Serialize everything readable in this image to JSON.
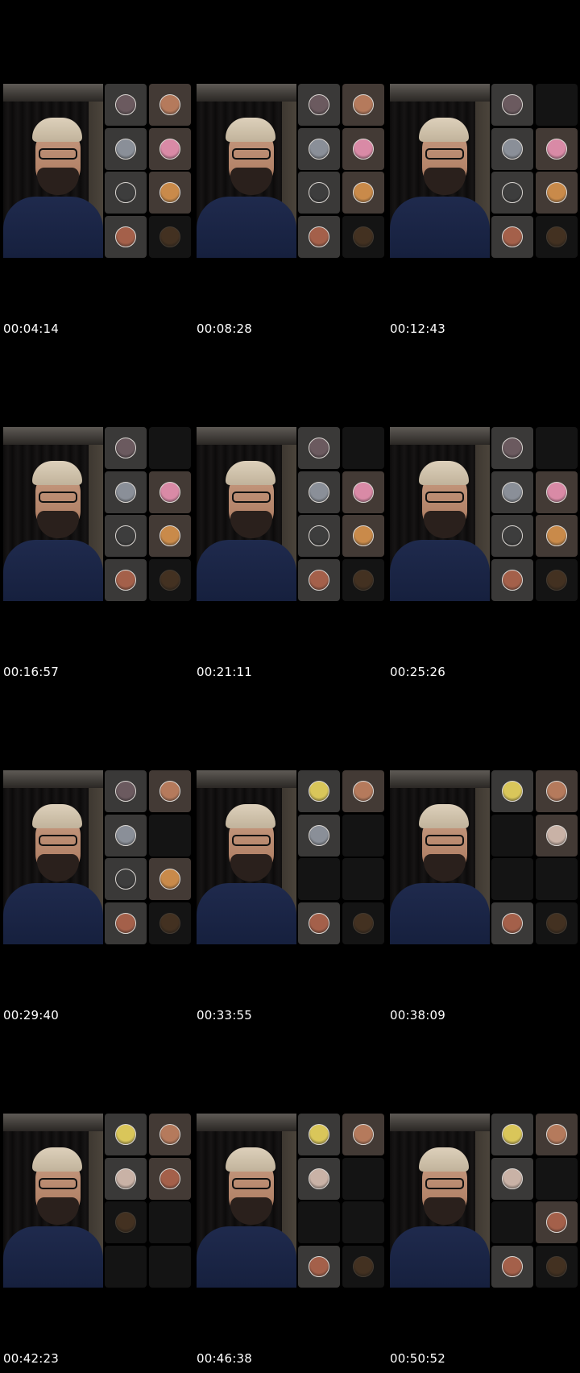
{
  "avatar_colors": {
    "p1": "#6b5a5f",
    "p2": "#b57a5c",
    "p3": "#8a8f98",
    "p4": "#d98aa6",
    "p5": "#3d3d3d",
    "p6": "#c98a4a",
    "p7": "#a4604a",
    "p8": "#6b4a2c",
    "p9": "#d9c65a",
    "p10": "#c9b2a6"
  },
  "frames": [
    {
      "timestamp": "00:04:14",
      "tiles": [
        {
          "state": "on",
          "avatar": "p1"
        },
        {
          "state": "on",
          "avatar": "p2"
        },
        {
          "state": "on",
          "avatar": "p3"
        },
        {
          "state": "on",
          "avatar": "p4"
        },
        {
          "state": "on",
          "avatar": "p5"
        },
        {
          "state": "on",
          "avatar": "p6"
        },
        {
          "state": "on",
          "avatar": "p7"
        },
        {
          "state": "off",
          "avatar": "p8"
        }
      ]
    },
    {
      "timestamp": "00:08:28",
      "tiles": [
        {
          "state": "on",
          "avatar": "p1"
        },
        {
          "state": "on",
          "avatar": "p2"
        },
        {
          "state": "on",
          "avatar": "p3"
        },
        {
          "state": "on",
          "avatar": "p4"
        },
        {
          "state": "on",
          "avatar": "p5"
        },
        {
          "state": "on",
          "avatar": "p6"
        },
        {
          "state": "on",
          "avatar": "p7"
        },
        {
          "state": "off",
          "avatar": "p8"
        }
      ]
    },
    {
      "timestamp": "00:12:43",
      "tiles": [
        {
          "state": "on",
          "avatar": "p1"
        },
        {
          "state": "empty",
          "avatar": ""
        },
        {
          "state": "on",
          "avatar": "p3"
        },
        {
          "state": "on",
          "avatar": "p4"
        },
        {
          "state": "on",
          "avatar": "p5"
        },
        {
          "state": "on",
          "avatar": "p6"
        },
        {
          "state": "on",
          "avatar": "p7"
        },
        {
          "state": "off",
          "avatar": "p8"
        }
      ]
    },
    {
      "timestamp": "00:16:57",
      "tiles": [
        {
          "state": "on",
          "avatar": "p1"
        },
        {
          "state": "empty",
          "avatar": ""
        },
        {
          "state": "on",
          "avatar": "p3"
        },
        {
          "state": "on",
          "avatar": "p4"
        },
        {
          "state": "on",
          "avatar": "p5"
        },
        {
          "state": "on",
          "avatar": "p6"
        },
        {
          "state": "on",
          "avatar": "p7"
        },
        {
          "state": "off",
          "avatar": "p8"
        }
      ]
    },
    {
      "timestamp": "00:21:11",
      "tiles": [
        {
          "state": "on",
          "avatar": "p1"
        },
        {
          "state": "empty",
          "avatar": ""
        },
        {
          "state": "on",
          "avatar": "p3"
        },
        {
          "state": "on",
          "avatar": "p4"
        },
        {
          "state": "on",
          "avatar": "p5"
        },
        {
          "state": "on",
          "avatar": "p6"
        },
        {
          "state": "on",
          "avatar": "p7"
        },
        {
          "state": "off",
          "avatar": "p8"
        }
      ]
    },
    {
      "timestamp": "00:25:26",
      "tiles": [
        {
          "state": "on",
          "avatar": "p1"
        },
        {
          "state": "empty",
          "avatar": ""
        },
        {
          "state": "on",
          "avatar": "p3"
        },
        {
          "state": "on",
          "avatar": "p4"
        },
        {
          "state": "on",
          "avatar": "p5"
        },
        {
          "state": "on",
          "avatar": "p6"
        },
        {
          "state": "on",
          "avatar": "p7"
        },
        {
          "state": "off",
          "avatar": "p8"
        }
      ]
    },
    {
      "timestamp": "00:29:40",
      "tiles": [
        {
          "state": "on",
          "avatar": "p1"
        },
        {
          "state": "on",
          "avatar": "p2"
        },
        {
          "state": "on",
          "avatar": "p3"
        },
        {
          "state": "empty",
          "avatar": ""
        },
        {
          "state": "on",
          "avatar": "p5"
        },
        {
          "state": "on",
          "avatar": "p6"
        },
        {
          "state": "on",
          "avatar": "p7"
        },
        {
          "state": "off",
          "avatar": "p8"
        }
      ]
    },
    {
      "timestamp": "00:33:55",
      "tiles": [
        {
          "state": "on",
          "avatar": "p9"
        },
        {
          "state": "on",
          "avatar": "p2"
        },
        {
          "state": "on",
          "avatar": "p3"
        },
        {
          "state": "empty",
          "avatar": ""
        },
        {
          "state": "empty",
          "avatar": ""
        },
        {
          "state": "empty",
          "avatar": ""
        },
        {
          "state": "on",
          "avatar": "p7"
        },
        {
          "state": "off",
          "avatar": "p8"
        }
      ]
    },
    {
      "timestamp": "00:38:09",
      "tiles": [
        {
          "state": "on",
          "avatar": "p9"
        },
        {
          "state": "on",
          "avatar": "p2"
        },
        {
          "state": "empty",
          "avatar": ""
        },
        {
          "state": "on",
          "avatar": "p10"
        },
        {
          "state": "empty",
          "avatar": ""
        },
        {
          "state": "empty",
          "avatar": ""
        },
        {
          "state": "on",
          "avatar": "p7"
        },
        {
          "state": "off",
          "avatar": "p8"
        }
      ]
    },
    {
      "timestamp": "00:42:23",
      "tiles": [
        {
          "state": "on",
          "avatar": "p9"
        },
        {
          "state": "on",
          "avatar": "p2"
        },
        {
          "state": "on",
          "avatar": "p10"
        },
        {
          "state": "on",
          "avatar": "p7"
        },
        {
          "state": "off",
          "avatar": "p8"
        },
        {
          "state": "empty",
          "avatar": ""
        },
        {
          "state": "empty",
          "avatar": ""
        },
        {
          "state": "empty",
          "avatar": ""
        }
      ]
    },
    {
      "timestamp": "00:46:38",
      "tiles": [
        {
          "state": "on",
          "avatar": "p9"
        },
        {
          "state": "on",
          "avatar": "p2"
        },
        {
          "state": "on",
          "avatar": "p10"
        },
        {
          "state": "empty",
          "avatar": ""
        },
        {
          "state": "empty",
          "avatar": ""
        },
        {
          "state": "empty",
          "avatar": ""
        },
        {
          "state": "on",
          "avatar": "p7"
        },
        {
          "state": "off",
          "avatar": "p8"
        }
      ]
    },
    {
      "timestamp": "00:50:52",
      "tiles": [
        {
          "state": "on",
          "avatar": "p9"
        },
        {
          "state": "on",
          "avatar": "p2"
        },
        {
          "state": "on",
          "avatar": "p10"
        },
        {
          "state": "empty",
          "avatar": ""
        },
        {
          "state": "empty",
          "avatar": ""
        },
        {
          "state": "on",
          "avatar": "p7"
        },
        {
          "state": "on",
          "avatar": "p7"
        },
        {
          "state": "off",
          "avatar": "p8"
        }
      ]
    }
  ]
}
